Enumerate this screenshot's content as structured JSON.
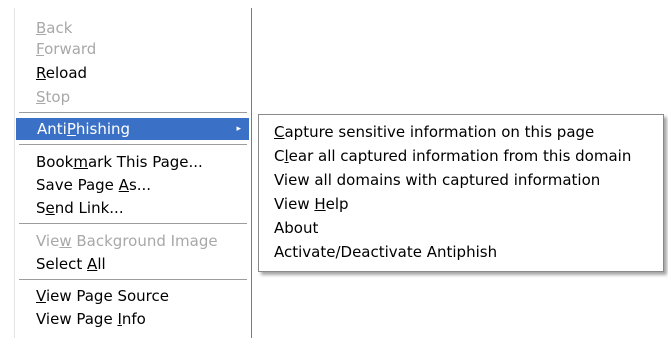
{
  "context_menu": {
    "items": [
      {
        "pre": "",
        "key": "B",
        "post": "ack"
      },
      {
        "pre": "",
        "key": "F",
        "post": "orward"
      },
      {
        "pre": "",
        "key": "R",
        "post": "eload"
      },
      {
        "pre": "",
        "key": "S",
        "post": "top"
      },
      {
        "pre": "Anti",
        "key": "P",
        "post": "hishing"
      },
      {
        "pre": "Book",
        "key": "m",
        "post": "ark This Page..."
      },
      {
        "pre": "Save Page ",
        "key": "A",
        "post": "s..."
      },
      {
        "pre": "S",
        "key": "e",
        "post": "nd Link..."
      },
      {
        "pre": "Vie",
        "key": "w",
        "post": " Background Image"
      },
      {
        "pre": "Select ",
        "key": "A",
        "post": "ll"
      },
      {
        "pre": "",
        "key": "V",
        "post": "iew Page Source"
      },
      {
        "pre": "View Page ",
        "key": "I",
        "post": "nfo"
      }
    ],
    "submenu_arrow": "▸"
  },
  "submenu": {
    "items": [
      {
        "pre": "",
        "key": "C",
        "post": "apture sensitive information on this page"
      },
      {
        "pre": "C",
        "key": "l",
        "post": "ear all captured information from this domain"
      },
      {
        "pre": "View all domains with captured information",
        "key": "",
        "post": ""
      },
      {
        "pre": "View ",
        "key": "H",
        "post": "elp"
      },
      {
        "pre": "About",
        "key": "",
        "post": ""
      },
      {
        "pre": "Activate/Deactivate Antiphish",
        "key": "",
        "post": ""
      }
    ]
  },
  "colors": {
    "highlight": "#3a70c6",
    "disabled_text": "#a8a8a8"
  },
  "icons": {
    "submenu_arrow": "chevron-right-icon"
  }
}
